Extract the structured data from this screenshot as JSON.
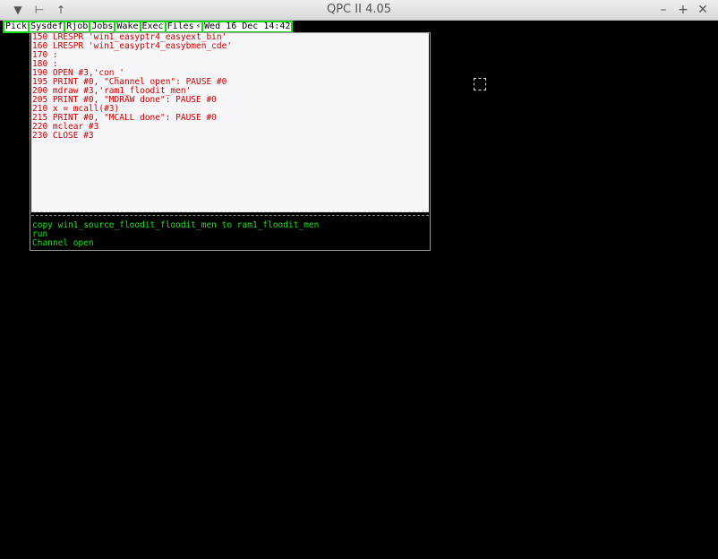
{
  "window": {
    "title": "QPC II 4.05"
  },
  "titlebar": {
    "left_buttons": [
      {
        "icon": "menu-triangle-icon",
        "glyph": "▼"
      },
      {
        "icon": "pin-icon",
        "glyph": "⊢"
      },
      {
        "icon": "keep-above-icon",
        "glyph": "↑"
      }
    ],
    "right_buttons": [
      {
        "icon": "minimize-icon",
        "glyph": "–"
      },
      {
        "icon": "maximize-icon",
        "glyph": "+"
      },
      {
        "icon": "close-icon",
        "glyph": "✕"
      }
    ]
  },
  "ql_buttons": [
    {
      "label": "Pick"
    },
    {
      "label": "Sysdef"
    },
    {
      "label": "Rjob"
    },
    {
      "label": "Jobs"
    },
    {
      "label": "Wake"
    },
    {
      "label": "Exec"
    },
    {
      "label": "Files"
    },
    {
      "label": "Wed 16 Dec   14:42"
    }
  ],
  "listing": [
    "150 LRESPR 'win1_easyptr4_easyext_bin'",
    "160 LRESPR 'win1_easyptr4_easybmen_cde'",
    "170 :",
    "180 :",
    "190 OPEN #3,'con_'",
    "195 PRINT #0, \"Channel open\": PAUSE #0",
    "200 mdraw #3,'ram1_floodit_men'",
    "205 PRINT #0, \"MDRAW done\": PAUSE #0",
    "210 x = mcall(#3)",
    "215 PRINT #0, \"MCALL done\": PAUSE #0",
    "220 mclear #3",
    "230 CLOSE #3"
  ],
  "command": [
    "copy win1_source_floodit_floodit_men to ram1_floodit_men",
    "run",
    "Channel open"
  ],
  "colors": {
    "listing_text": "#c80000",
    "command_text": "#22e022",
    "button_border": "#14d414",
    "background": "#000000"
  }
}
